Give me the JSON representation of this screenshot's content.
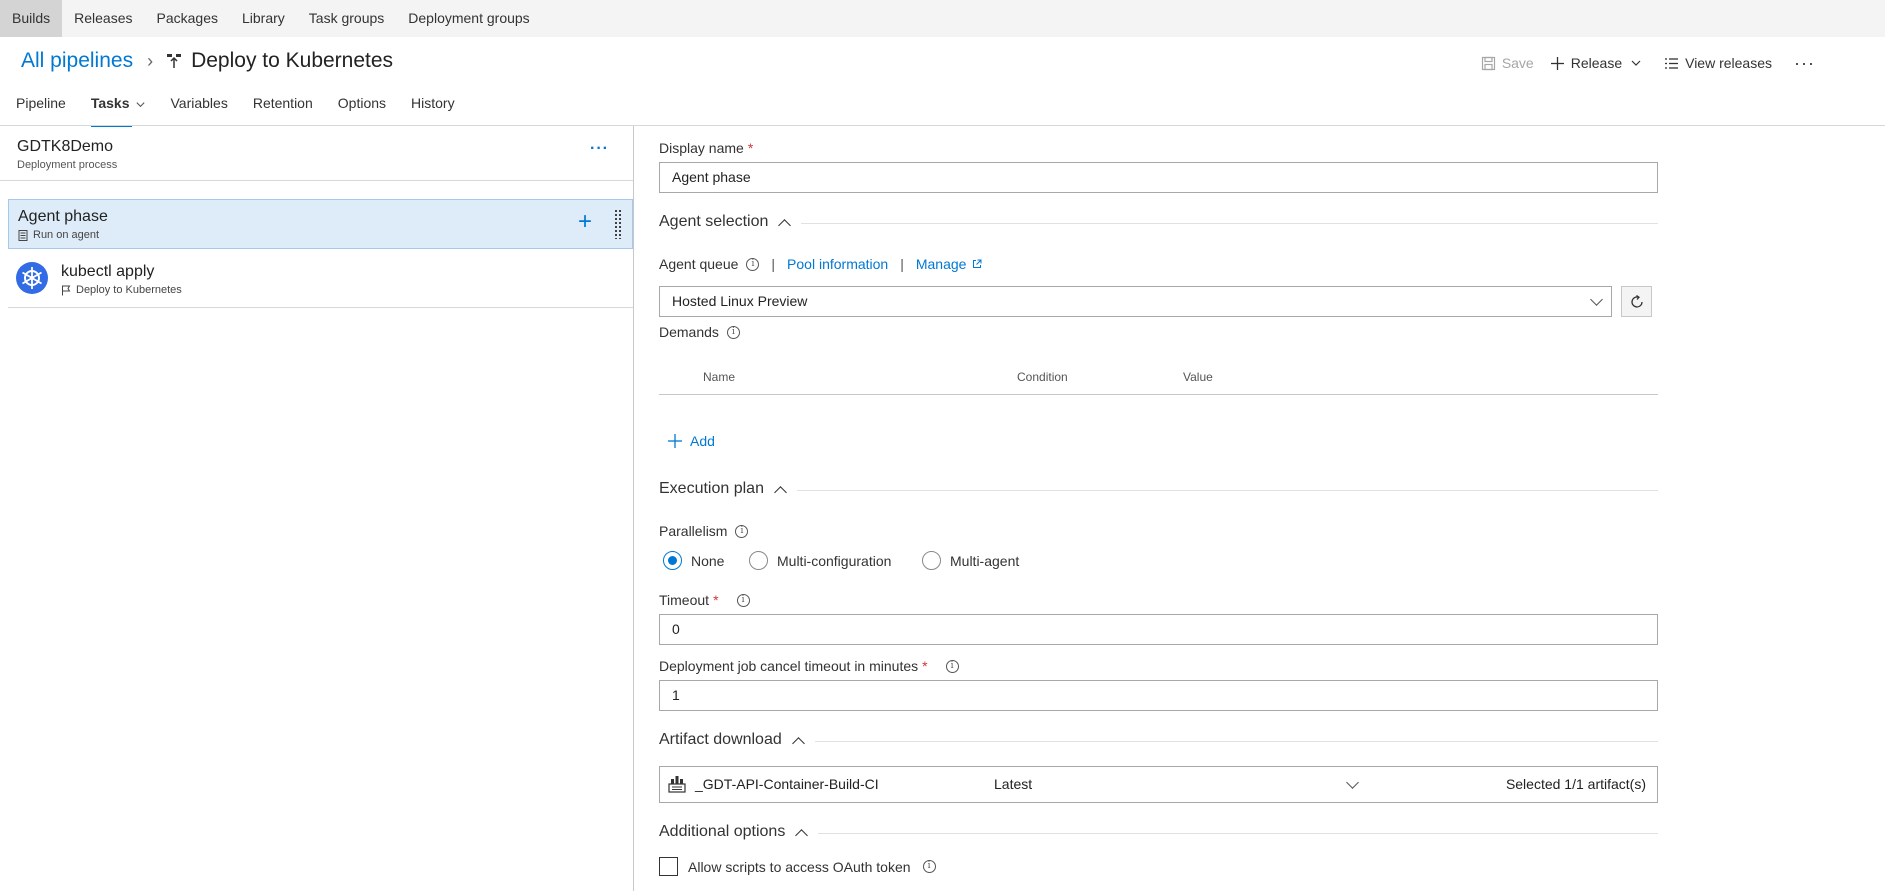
{
  "topnav": {
    "items": [
      "Builds",
      "Releases",
      "Packages",
      "Library",
      "Task groups",
      "Deployment groups"
    ],
    "active": "Builds"
  },
  "header": {
    "breadcrumb_link": "All pipelines",
    "title": "Deploy to Kubernetes",
    "actions": {
      "save": "Save",
      "release": "Release",
      "view_releases": "View releases"
    }
  },
  "tabs": [
    "Pipeline",
    "Tasks",
    "Variables",
    "Retention",
    "Options",
    "History"
  ],
  "active_tab": "Tasks",
  "left": {
    "process": {
      "name": "GDTK8Demo",
      "subtitle": "Deployment process"
    },
    "phase": {
      "name": "Agent phase",
      "subtitle": "Run on agent"
    },
    "task": {
      "name": "kubectl apply",
      "subtitle": "Deploy to Kubernetes"
    }
  },
  "form": {
    "display_name": {
      "label": "Display name",
      "value": "Agent phase"
    },
    "agent_selection": {
      "title": "Agent selection",
      "queue_label": "Agent queue",
      "pool_info": "Pool information",
      "manage": "Manage",
      "queue_value": "Hosted Linux Preview"
    },
    "demands": {
      "label": "Demands",
      "columns": [
        "Name",
        "Condition",
        "Value"
      ],
      "add": "Add"
    },
    "execution_plan": {
      "title": "Execution plan",
      "parallelism_label": "Parallelism",
      "options": [
        "None",
        "Multi-configuration",
        "Multi-agent"
      ],
      "selected": "None",
      "timeout_label": "Timeout",
      "timeout_value": "0",
      "cancel_label": "Deployment job cancel timeout in minutes",
      "cancel_value": "1"
    },
    "artifact_download": {
      "title": "Artifact download",
      "artifact_name": "_GDT-API-Container-Build-CI",
      "version": "Latest",
      "selected": "Selected 1/1 artifact(s)"
    },
    "additional_options": {
      "title": "Additional options",
      "oauth_label": "Allow scripts to access OAuth token"
    }
  },
  "colors": {
    "accent": "#0078d4",
    "selected_bg": "#deecf9",
    "required": "#d13438",
    "kubernetes": "#326ce5"
  }
}
